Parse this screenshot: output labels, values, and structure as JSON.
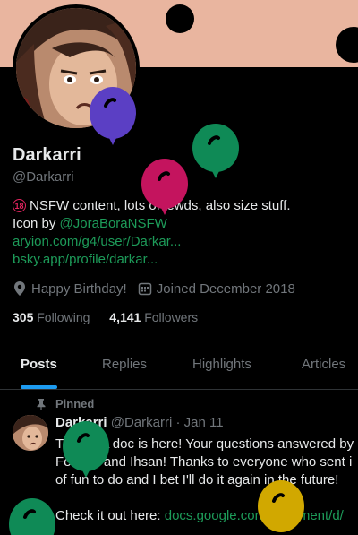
{
  "profile": {
    "name": "Darkarri",
    "handle": "@Darkarri",
    "bio_line1": "NSFW content, lots of lewds, also size stuff.",
    "bio_line2_prefix": "Icon by ",
    "bio_line2_mention": "@JoraBoraNSFW",
    "link1": "aryion.com/g4/user/Darkar...",
    "link2": "bsky.app/profile/darkar...",
    "badge_18": "18",
    "birthday": "Happy Birthday!",
    "joined": "Joined December 2018",
    "following_count": "305",
    "following_label": "Following",
    "followers_count": "4,141",
    "followers_label": "Followers"
  },
  "tabs": [
    "Posts",
    "Replies",
    "Highlights",
    "Articles"
  ],
  "pinned_post": {
    "pinned_label": "Pinned",
    "author_name": "Darkarri",
    "author_handle": "@Darkarri",
    "separator": "·",
    "date": "Jan 11",
    "line1": "The Q+A doc is here! Your questions answered by",
    "line2": "Felicity, and Ihsan! Thanks to everyone who sent i",
    "line3": "of fun to do and I bet I'll do it again in the future!",
    "line4": "",
    "line5_prefix": "Check it out here: ",
    "line5_link": "docs.google.com/document/d/"
  },
  "colors": {
    "accent_link": "#1d9b59",
    "tab_underline": "#1d9bf0",
    "banner": "#e9b59f",
    "balloon_purple": "#5b3fc4",
    "balloon_green": "#0f8a56",
    "balloon_magenta": "#c4145e",
    "balloon_yellow": "#d1a800"
  },
  "icons": [
    "location-icon",
    "calendar-icon",
    "pin-icon",
    "balloon-icon"
  ]
}
